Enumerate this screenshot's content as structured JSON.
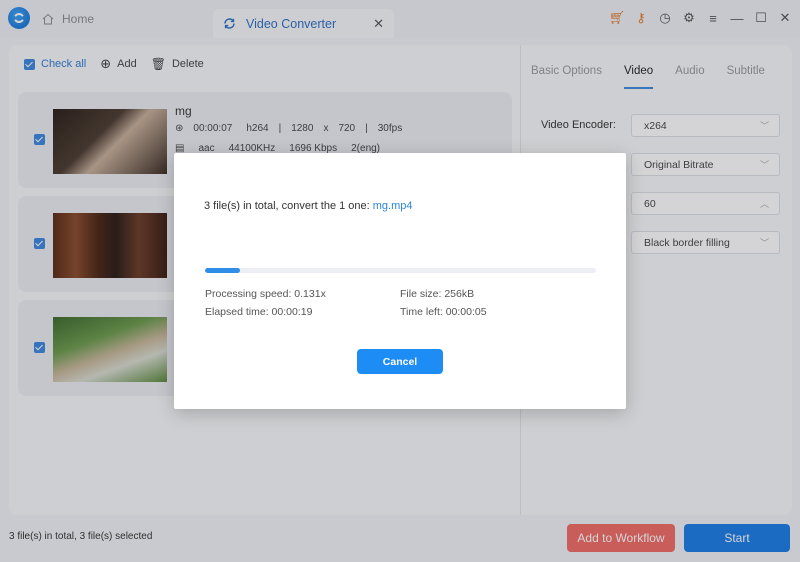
{
  "titlebar": {
    "home_tab": "Home",
    "active_tab": "Video Converter",
    "icons": [
      "cart-icon",
      "key-icon",
      "clock-icon",
      "gear-icon",
      "menu-icon",
      "minimize-icon",
      "maximize-icon",
      "close-icon"
    ]
  },
  "toolbar": {
    "check_all": "Check all",
    "add": "Add",
    "delete": "Delete"
  },
  "files": [
    {
      "name": "mg",
      "duration": "00:00:07",
      "codec": "h264",
      "width": "1280",
      "x": "x",
      "height": "720",
      "fps": "30fps",
      "audio_codec": "aac",
      "sample_rate": "44100KHz",
      "bitrate": "1696 Kbps",
      "channels": "2(eng)",
      "checked": true
    },
    {
      "checked": true
    },
    {
      "checked": true
    }
  ],
  "settings": {
    "tabs": [
      "Basic Options",
      "Video",
      "Audio",
      "Subtitle"
    ],
    "active_tab": "Video",
    "video_encoder_label": "Video Encoder:",
    "video_encoder": "x264",
    "bitrate": "Original Bitrate",
    "frame_rate": "60",
    "resize_mode": "Black border filling"
  },
  "footer": {
    "status": "3 file(s) in total, 3 file(s) selected",
    "add_to_workflow": "Add to Workflow",
    "start": "Start"
  },
  "dialog": {
    "title_prefix": "3 file(s) in total, convert the 1 one: ",
    "current_file": "mg.mp4",
    "progress_percent": 9,
    "processing_speed": "Processing speed: 0.131x",
    "file_size": "File size: 256kB",
    "elapsed_time": "Elapsed time: 00:00:19",
    "time_left": "Time left: 00:00:05",
    "cancel": "Cancel"
  },
  "colors": {
    "accent": "#1a7ce8",
    "workflow": "#f26b63",
    "link": "#2b86d6"
  }
}
